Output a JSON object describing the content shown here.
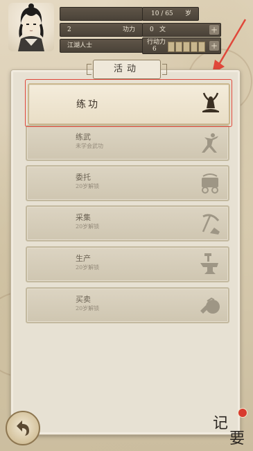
{
  "status": {
    "age_value": "10 / 65",
    "age_unit": "岁",
    "power_value": "2",
    "power_label": "功力",
    "money_value": "0",
    "money_unit": "文",
    "rank_title": "江湖人士",
    "action_label": "行动力",
    "action_value": "6",
    "plus_label": "+"
  },
  "panel": {
    "title": "活动"
  },
  "activities": [
    {
      "name": "练功",
      "sub": "",
      "icon": "meditation-icon",
      "active": true
    },
    {
      "name": "练武",
      "sub": "未学会武功",
      "icon": "martial-arts-icon",
      "active": false
    },
    {
      "name": "委托",
      "sub": "20岁解锁",
      "icon": "cart-icon",
      "active": false
    },
    {
      "name": "采集",
      "sub": "20岁解锁",
      "icon": "pickaxe-icon",
      "active": false
    },
    {
      "name": "生产",
      "sub": "20岁解锁",
      "icon": "anvil-icon",
      "active": false
    },
    {
      "name": "买卖",
      "sub": "20岁解锁",
      "icon": "money-bag-icon",
      "active": false
    }
  ],
  "bottom": {
    "notes_char1": "记",
    "notes_char2": "要"
  },
  "colors": {
    "highlight": "#e0473a",
    "arrow": "#e0473a"
  }
}
